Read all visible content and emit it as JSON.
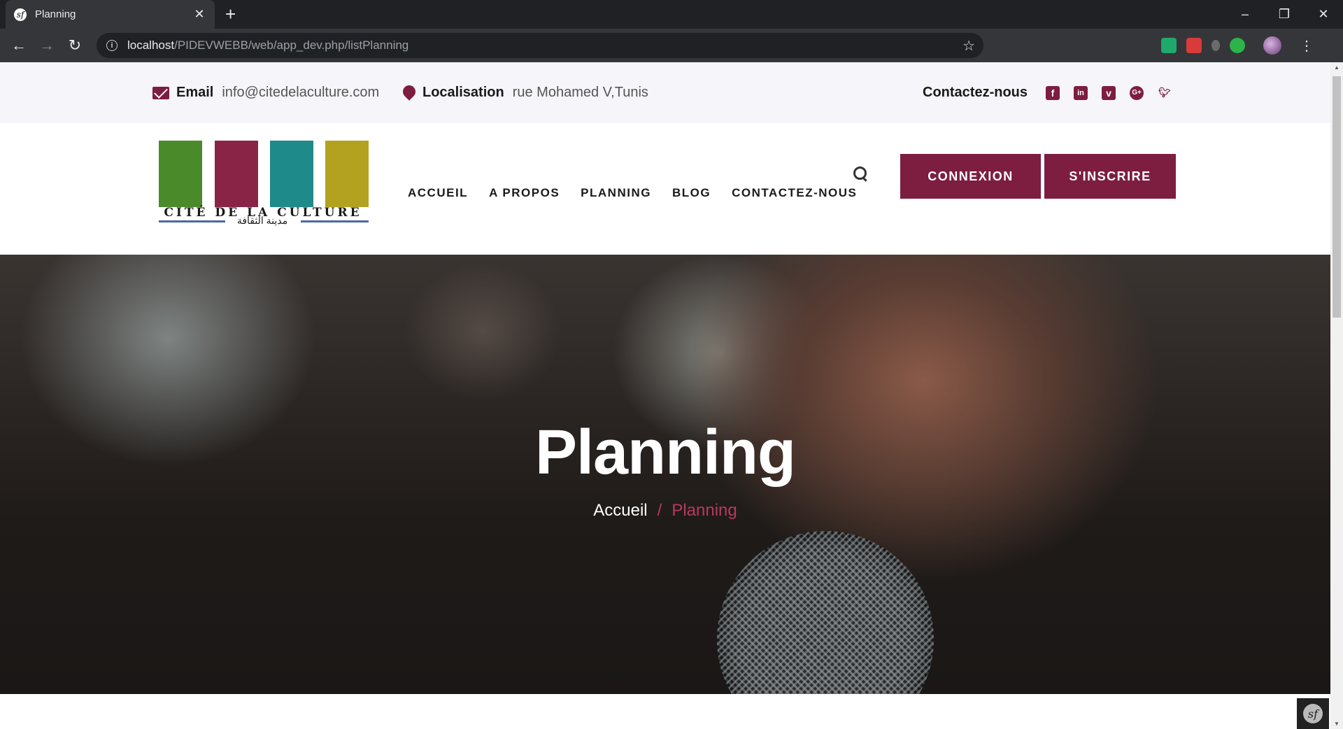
{
  "browser": {
    "tab_title": "Planning",
    "favicon": "sf",
    "url_host": "localhost",
    "url_path": "/PIDEVWEBB/web/app_dev.php/listPlanning"
  },
  "topbar": {
    "email_label": "Email",
    "email_value": "info@citedelaculture.com",
    "location_label": "Localisation",
    "location_value": "rue Mohamed V,Tunis",
    "contact_label": "Contactez-nous",
    "socials": [
      "facebook-icon",
      "linkedin-icon",
      "vimeo-icon",
      "google-plus-icon",
      "twitter-icon"
    ]
  },
  "logo": {
    "text": "CITÉ DE LA CULTURE",
    "arabic": "مدينة الثقافة",
    "colors": [
      "#4a8a2a",
      "#8a2447",
      "#1f8a8a",
      "#b3a21f"
    ]
  },
  "nav": {
    "items": [
      "ACCUEIL",
      "A PROPOS",
      "PLANNING",
      "BLOG",
      "CONTACTEZ-NOUS"
    ]
  },
  "buttons": {
    "login": "CONNEXION",
    "signup": "S'INSCRIRE"
  },
  "hero": {
    "title": "Planning",
    "breadcrumb_home": "Accueil",
    "breadcrumb_sep": "/",
    "breadcrumb_current": "Planning"
  },
  "colors": {
    "accent": "#7d1d3f",
    "crumb_active": "#b63a5f"
  }
}
